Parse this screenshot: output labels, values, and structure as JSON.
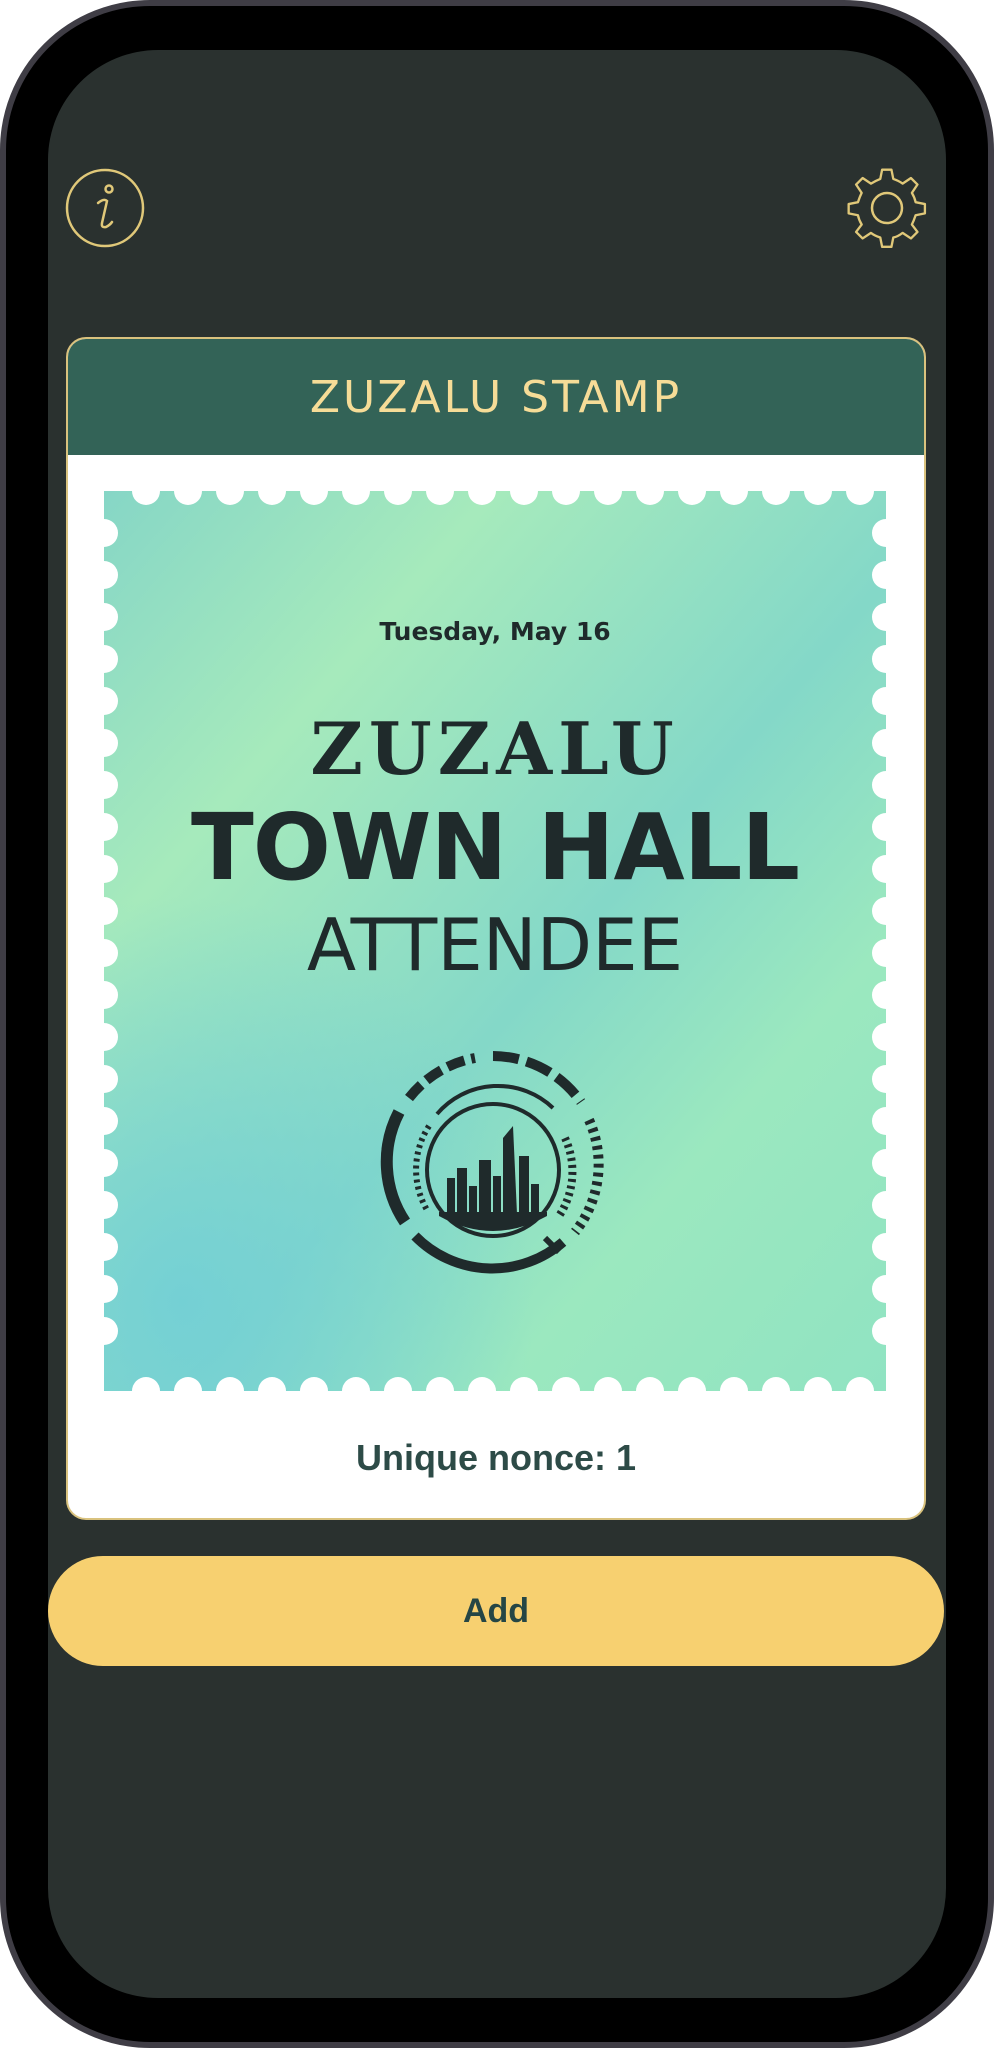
{
  "header": {
    "info_icon": "info-icon",
    "settings_icon": "gear-icon"
  },
  "card": {
    "title": "ZUZALU STAMP",
    "stamp": {
      "date": "Tuesday, May 16",
      "org": "ZUZALU",
      "event": "TOWN HALL",
      "role": "ATTENDEE",
      "emblem_icon": "city-skyline-emblem-icon"
    },
    "nonce_text": "Unique nonce: 1"
  },
  "actions": {
    "add_label": "Add"
  },
  "colors": {
    "background": "#2a312f",
    "card_header": "#336357",
    "card_title": "#f6dc97",
    "accent_button": "#f7d070",
    "stamp_gradient_a": "#9fe6b8",
    "stamp_gradient_b": "#7fd3c9",
    "text_dark": "#1f2a2b"
  }
}
